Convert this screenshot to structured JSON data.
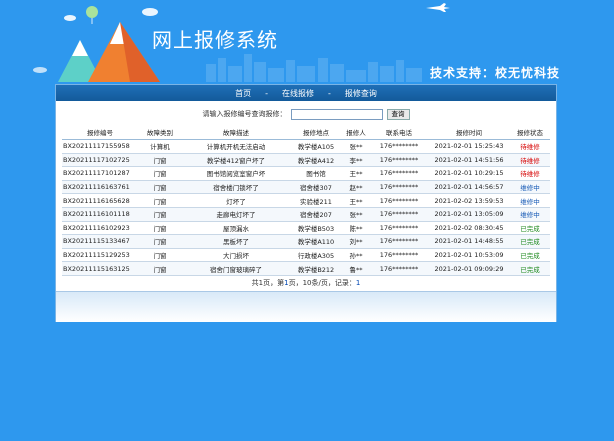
{
  "header": {
    "title": "网上报修系统",
    "support": "技术支持：校无忧科技"
  },
  "nav": {
    "home": "首页",
    "sep": "-",
    "online_repair": "在线报修",
    "repair_query": "报修查询"
  },
  "search": {
    "label": "请输入报修编号查询报修：",
    "value": "",
    "button": "查询"
  },
  "table": {
    "headers": [
      "报修编号",
      "故障类别",
      "故障描述",
      "报修地点",
      "报修人",
      "联系电话",
      "报修时间",
      "报修状态"
    ],
    "rows": [
      [
        "BX20211117155958",
        "计算机",
        "计算机开机无法启动",
        "教学楼A105",
        "张**",
        "176********",
        "2021-02-01 15:25:43",
        "待维修",
        "red"
      ],
      [
        "BX20211117102725",
        "门窗",
        "教学楼412窗户坏了",
        "教学楼A412",
        "李**",
        "176********",
        "2021-02-01 14:51:56",
        "待维修",
        "red"
      ],
      [
        "BX20211117101287",
        "门窗",
        "图书馆阅览室窗户坏",
        "图书馆",
        "王**",
        "176********",
        "2021-02-01 10:29:15",
        "待维修",
        "red"
      ],
      [
        "BX20211116163761",
        "门窗",
        "宿舍楼门锁坏了",
        "宿舍楼307",
        "赵**",
        "176********",
        "2021-02-01 14:56:57",
        "维修中",
        "blue"
      ],
      [
        "BX20211116165628",
        "门窗",
        "灯坏了",
        "实验楼211",
        "王**",
        "176********",
        "2021-02-02 13:59:53",
        "维修中",
        "blue"
      ],
      [
        "BX20211116101118",
        "门窗",
        "走廊电灯坏了",
        "宿舍楼207",
        "张**",
        "176********",
        "2021-02-01 13:05:09",
        "维修中",
        "blue"
      ],
      [
        "BX20211116102923",
        "门窗",
        "屋顶漏水",
        "教学楼B503",
        "陈**",
        "176********",
        "2021-02-02 08:30:45",
        "已完成",
        "green"
      ],
      [
        "BX20211115133467",
        "门窗",
        "黑板坏了",
        "教学楼A110",
        "刘**",
        "176********",
        "2021-02-01 14:48:55",
        "已完成",
        "green"
      ],
      [
        "BX20211115129253",
        "门窗",
        "大门损坏",
        "行政楼A305",
        "孙**",
        "176********",
        "2021-02-01 10:53:09",
        "已完成",
        "green"
      ],
      [
        "BX20211115163125",
        "门窗",
        "宿舍门窗玻璃碎了",
        "教学楼B212",
        "鲁**",
        "176********",
        "2021-02-01 09:09:29",
        "已完成",
        "green"
      ]
    ]
  },
  "pager": {
    "prefix": "共1页，第",
    "current": "1",
    "mid": "页，10条/页，记录：",
    "total": "1"
  },
  "colors": {
    "background": "#2e98ee",
    "nav": "#1f6fb7",
    "status_pending": "#d60000",
    "status_in_progress": "#1156b4",
    "status_done": "#1f8a1f"
  }
}
